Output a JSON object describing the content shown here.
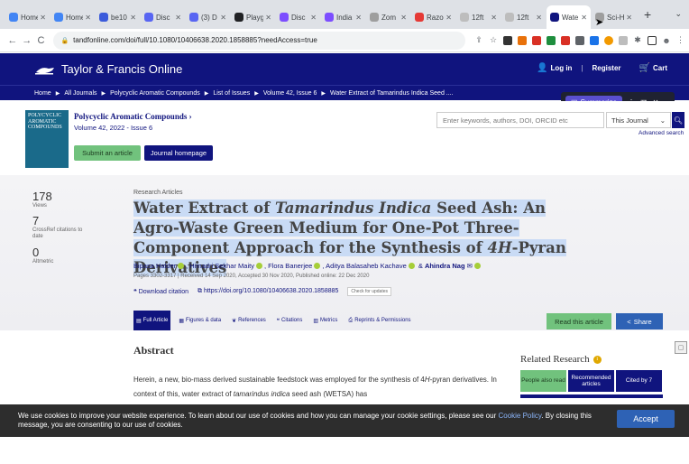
{
  "browser": {
    "tabs": [
      {
        "label": "Home",
        "color": "#4285f4"
      },
      {
        "label": "Home",
        "color": "#4285f4"
      },
      {
        "label": "be10",
        "color": "#3b5bdb"
      },
      {
        "label": "Disc",
        "color": "#5865f2"
      },
      {
        "label": "(3) D",
        "color": "#5865f2"
      },
      {
        "label": "Playg",
        "color": "#202124"
      },
      {
        "label": "Disc",
        "color": "#7c4dff"
      },
      {
        "label": "India",
        "color": "#7c4dff"
      },
      {
        "label": "Zom",
        "color": "#9e9e9e"
      },
      {
        "label": "Razo",
        "color": "#e53935"
      },
      {
        "label": "12ft",
        "color": "#bdbdbd"
      },
      {
        "label": "12ft",
        "color": "#bdbdbd"
      },
      {
        "label": "Wate",
        "color": "#10147e",
        "active": true
      },
      {
        "label": "Sci-H",
        "color": "#9e9e9e"
      }
    ],
    "new_tab": "+",
    "tab_menu": "⌄",
    "url": "tandfonline.com/doi/full/10.1080/10406638.2020.1858885?needAccess=true"
  },
  "header": {
    "logo": "Taylor & Francis Online",
    "login": "Log in",
    "register": "Register",
    "cart": "Cart"
  },
  "breadcrumb": [
    "Home",
    "All Journals",
    "Polycyclic Aromatic Compounds",
    "List of Issues",
    "Volume 42, Issue 6",
    "Water Extract of Tamarindus Indica Seed ...."
  ],
  "summarize": {
    "label": "Summarize"
  },
  "journal": {
    "cover_text": "POLYCYCLIC AROMATIC COMPOUNDS",
    "title": "Polycyclic Aromatic Compounds ›",
    "volume": "Volume 42, 2022 - Issue 6",
    "submit": "Submit an article",
    "homepage": "Journal homepage"
  },
  "search": {
    "placeholder": "Enter keywords, authors, DOI, ORCID etc",
    "scope": "This Journal",
    "advanced": "Advanced search"
  },
  "metrics": [
    {
      "value": "178",
      "label": "Views"
    },
    {
      "value": "7",
      "label": "CrossRef citations to date"
    },
    {
      "value": "0",
      "label": "Altmetric"
    }
  ],
  "article": {
    "type": "Research Articles",
    "title_part1": "Water Extract of ",
    "title_italic1": "Tamarindus Indica",
    "title_part2": " Seed Ash: An Agro-Waste Green Medium for One-Pot Three-Component Approach for the Synthesis of ",
    "title_italic2": "4H",
    "title_part3": "-Pyran Derivatives",
    "authors_text": "Bipasa Halder, Himadri Sekhar Maity, Flora Banerjee, Aditya Balasaheb Kachave & Ahindra Nag",
    "pages": "Pages 3302-3317 | Received 14 Sep 2020, Accepted 30 Nov 2020, Published online: 22 Dec 2020",
    "download": "Download citation",
    "doi": "https://doi.org/10.1080/10406638.2020.1858885",
    "check": "Check for updates"
  },
  "article_tabs": [
    {
      "label": "Full Article",
      "active": true
    },
    {
      "label": "Figures & data"
    },
    {
      "label": "References"
    },
    {
      "label": "Citations"
    },
    {
      "label": "Metrics"
    },
    {
      "label": "Reprints & Permissions"
    }
  ],
  "actions": {
    "read": "Read this article",
    "share": "Share"
  },
  "abstract": {
    "heading": "Abstract",
    "text_a": "Herein, a new, bio-mass derived sustainable feedstock was employed for the synthesis of 4",
    "text_h": "H",
    "text_b": "-pyran derivatives. In context of this, water extract of ",
    "text_italic": "tamarindus indica",
    "text_c": " seed ash (WETSA) has"
  },
  "related": {
    "heading": "Related Research",
    "tabs": [
      "People also read",
      "Recommended articles",
      "Cited by 7"
    ]
  },
  "cookie": {
    "text_a": "We use cookies to improve your website experience. To learn about our use of cookies and how you can manage your cookie settings, please see our ",
    "link": "Cookie Policy",
    "text_b": ". By closing this message, you are consenting to our use of cookies.",
    "accept": "Accept"
  }
}
